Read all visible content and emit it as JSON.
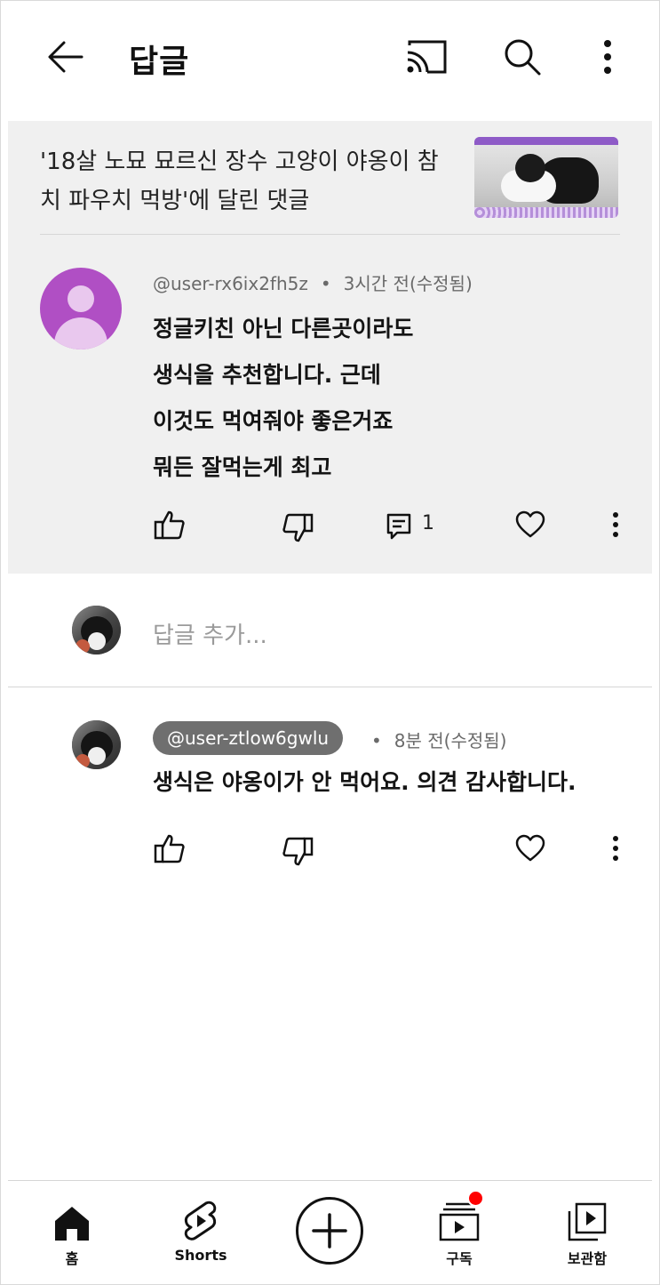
{
  "header": {
    "title": "답글",
    "back_icon": "arrow-left-icon",
    "cast_icon": "cast-icon",
    "search_icon": "search-icon",
    "more_icon": "more-vertical-icon"
  },
  "context": {
    "video_title": "'18살 노묘 묘르신 장수 고양이 야옹이 참치 파우치 먹방'에 달린 댓글"
  },
  "comment": {
    "author": "@user-rx6ix2fh5z",
    "time": "3시간 전(수정됨)",
    "lines": [
      "정글키친 아닌 다른곳이라도",
      "생식을 추천합니다. 근데",
      "이것도 먹여줘야 좋은거죠",
      "뭐든 잘먹는게 최고"
    ],
    "reply_count": "1"
  },
  "add_reply": {
    "placeholder": "답글 추가..."
  },
  "reply": {
    "author": "@user-ztlow6gwlu",
    "time": "8분 전(수정됨)",
    "text": "생식은 야옹이가 안 먹어요. 의견 감사합니다."
  },
  "nav": {
    "items": [
      {
        "label": "홈",
        "icon": "home-icon"
      },
      {
        "label": "Shorts",
        "icon": "shorts-icon"
      },
      {
        "label": "",
        "icon": "create-plus-icon"
      },
      {
        "label": "구독",
        "icon": "subscriptions-icon"
      },
      {
        "label": "보관함",
        "icon": "library-icon"
      }
    ]
  },
  "colors": {
    "highlight_bg": "#f0f0f0",
    "avatar_purple": "#b04fc4",
    "notification": "#ff0000",
    "handle_badge": "#6f6f6f"
  }
}
